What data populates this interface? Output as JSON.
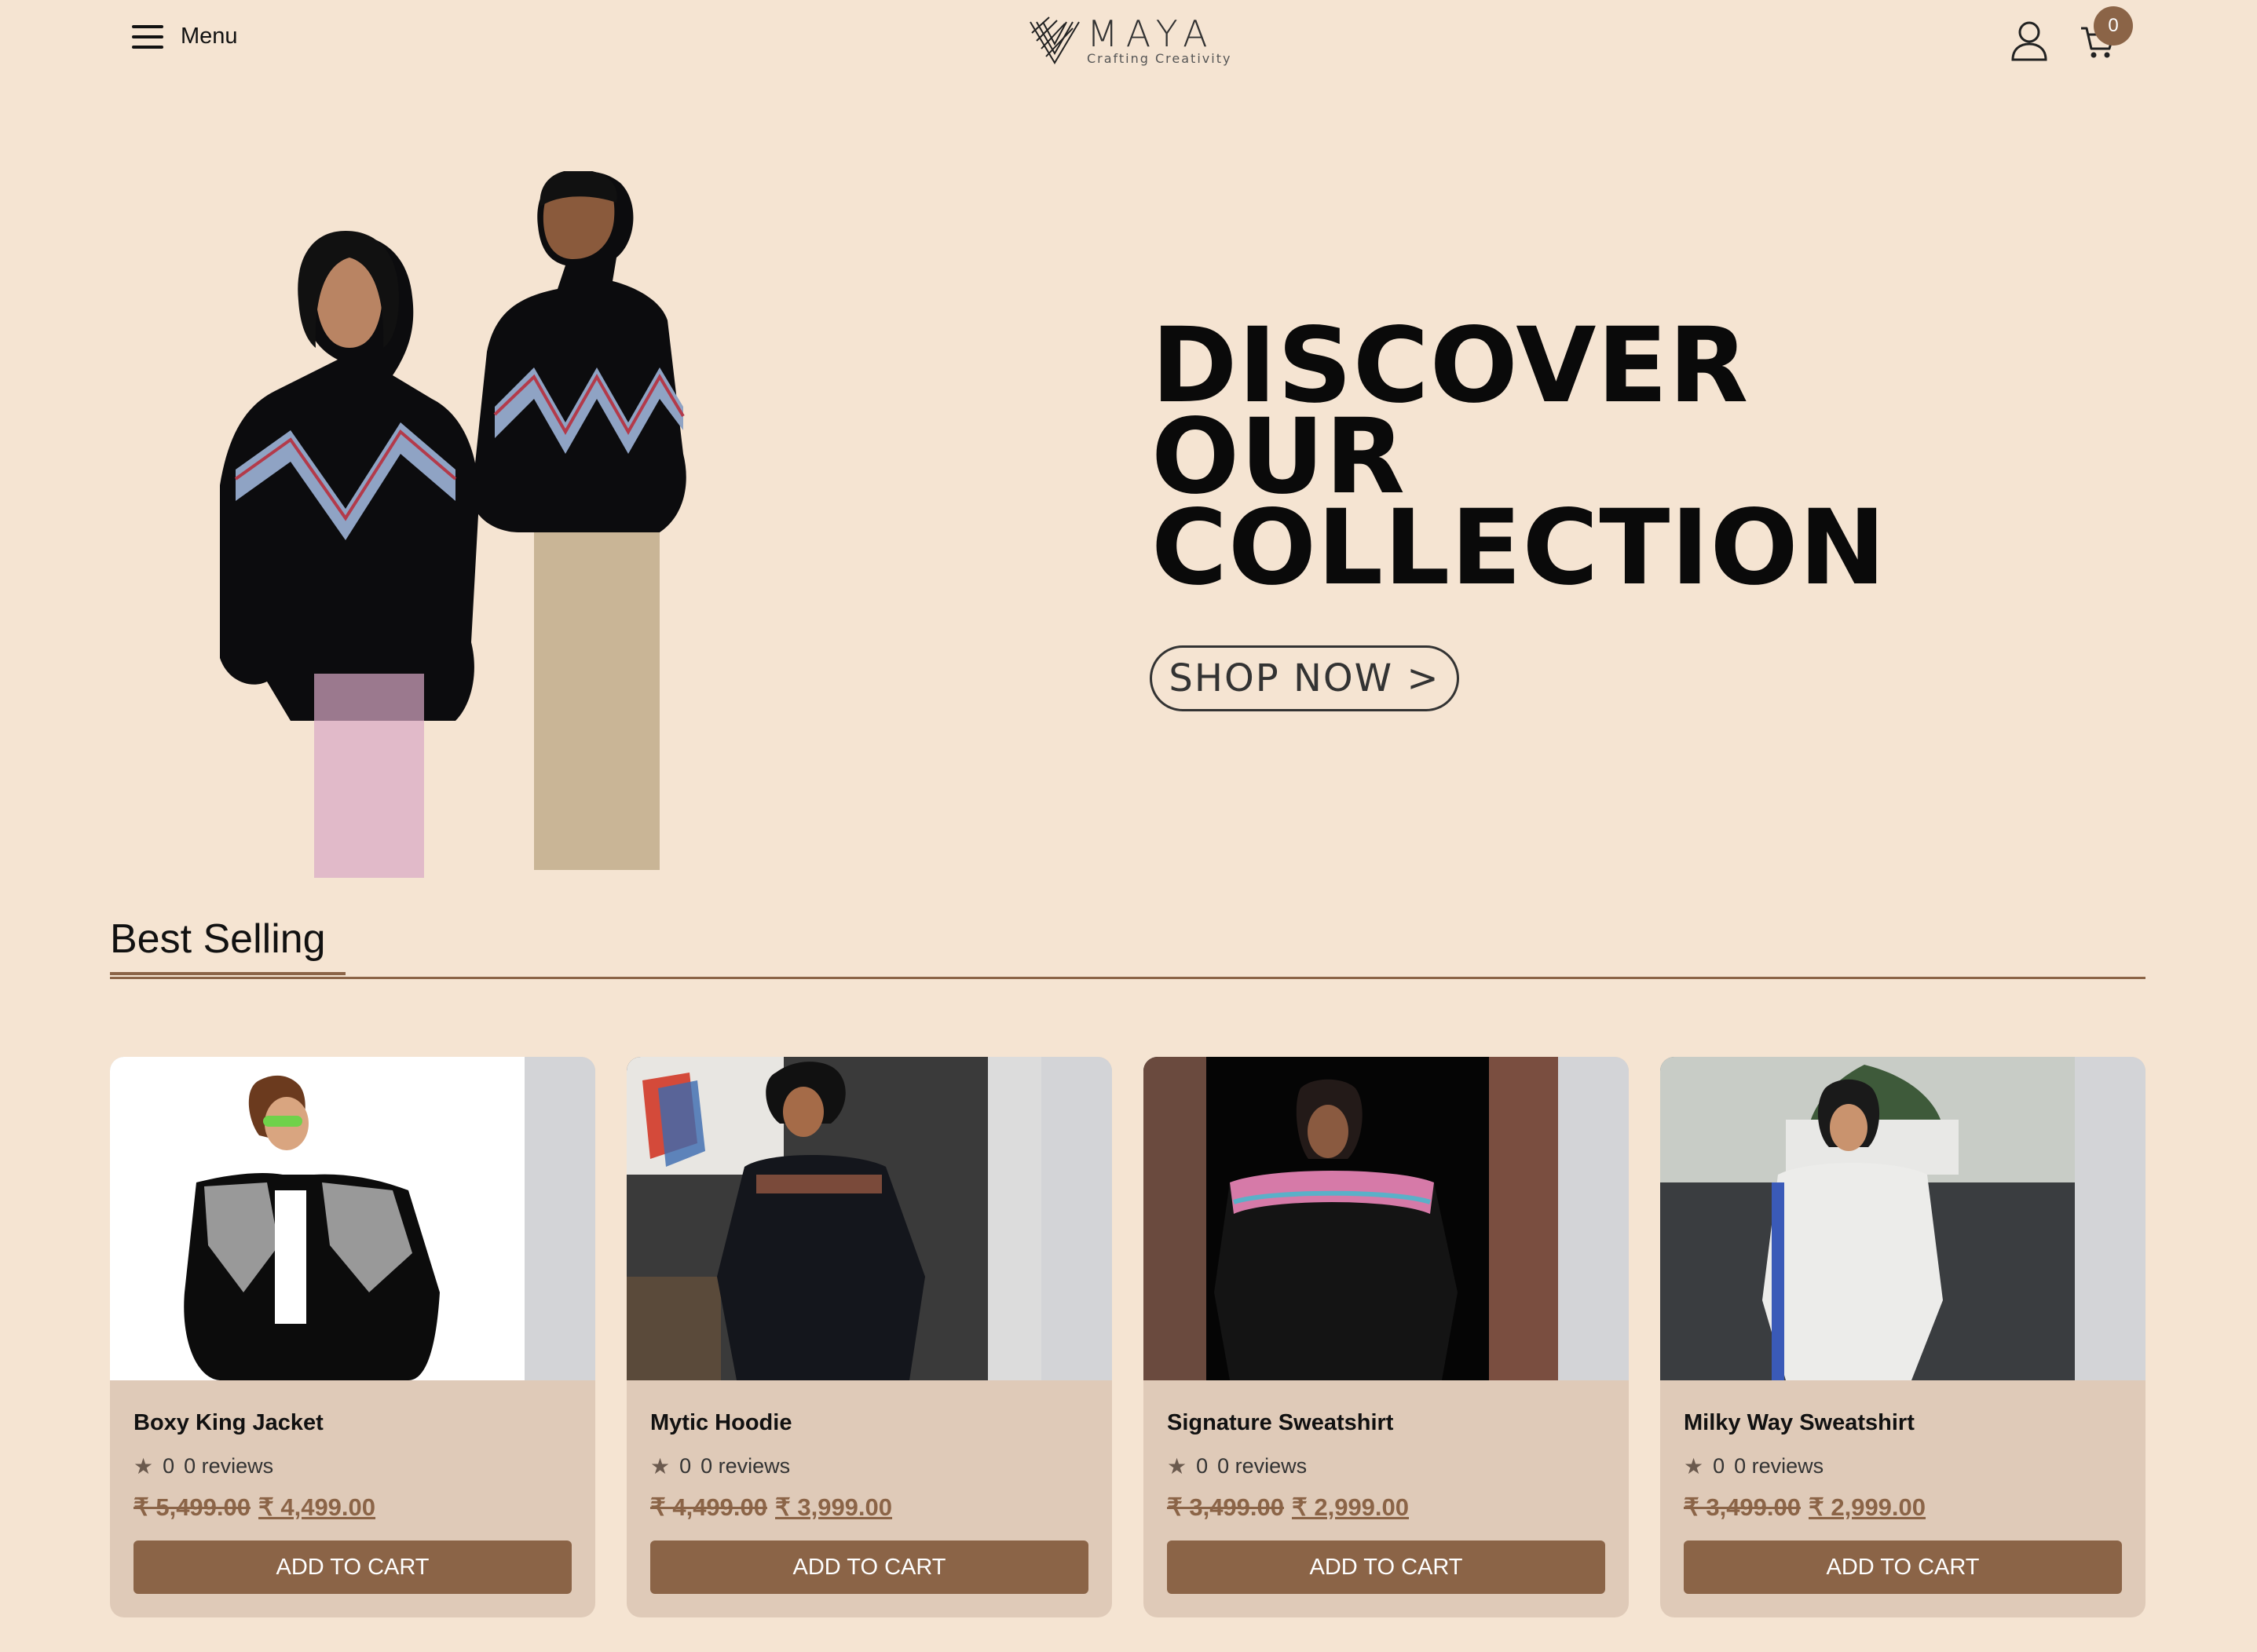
{
  "header": {
    "menu_label": "Menu",
    "logo_name": "MAYA",
    "logo_tagline": "Crafting Creativity",
    "cart_count": "0"
  },
  "hero": {
    "title_lines": [
      "DISCOVER",
      "OUR",
      "COLLECTION"
    ],
    "cta_label": "SHOP NOW >"
  },
  "best_selling": {
    "title": "Best Selling",
    "products": [
      {
        "name": "Boxy King Jacket",
        "rating": "0",
        "reviews": "0 reviews",
        "old_price": "₹ 5,499.00",
        "new_price": "₹ 4,499.00",
        "button": "ADD TO CART"
      },
      {
        "name": "Mytic Hoodie",
        "rating": "0",
        "reviews": "0 reviews",
        "old_price": "₹ 4,499.00",
        "new_price": "₹ 3,999.00",
        "button": "ADD TO CART"
      },
      {
        "name": "Signature Sweatshirt",
        "rating": "0",
        "reviews": "0 reviews",
        "old_price": "₹ 3,499.00",
        "new_price": "₹ 2,999.00",
        "button": "ADD TO CART"
      },
      {
        "name": "Milky Way Sweatshirt",
        "rating": "0",
        "reviews": "0 reviews",
        "old_price": "₹ 3,499.00",
        "new_price": "₹ 2,999.00",
        "button": "ADD TO CART"
      }
    ]
  },
  "colors": {
    "background": "#f5e4d2",
    "accent": "#8b6447",
    "card_bg": "#dfcab8",
    "image_placeholder": "#d3d4d7"
  },
  "icons": [
    "hamburger-icon",
    "logo-mark-icon",
    "user-icon",
    "cart-icon",
    "star-icon"
  ]
}
